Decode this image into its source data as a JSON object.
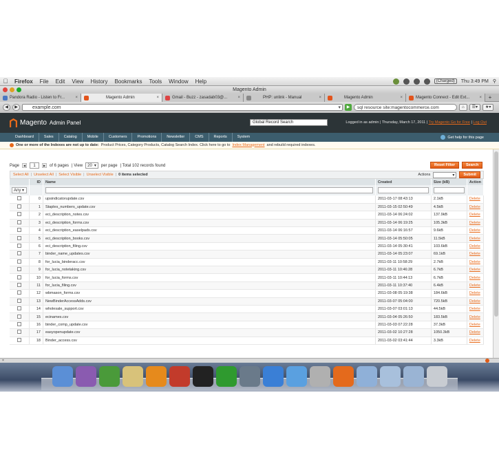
{
  "menubar": {
    "app": "Firefox",
    "items": [
      "File",
      "Edit",
      "View",
      "History",
      "Bookmarks",
      "Tools",
      "Window",
      "Help"
    ],
    "battery": "(Charged)",
    "clock": "Thu 3:49 PM"
  },
  "window": {
    "title": "Magento Admin"
  },
  "tabs": [
    {
      "label": "Pandora Radio - Listen to Fr...",
      "active": false
    },
    {
      "label": "Magento Admin",
      "active": true
    },
    {
      "label": "Gmail - Buzz - zasadab03@...",
      "active": false
    },
    {
      "label": "PHP: unlink - Manual",
      "active": false
    },
    {
      "label": "Magento Admin",
      "active": false
    },
    {
      "label": "Magento Connect - Edit Ext...",
      "active": false
    }
  ],
  "nav": {
    "url": "example.com",
    "search": "sql resource site:magentocommerce.com"
  },
  "header": {
    "logo": "Magento",
    "logo_sub": "Admin Panel",
    "global_search": "Global Record Search",
    "login_info": "Logged in as admin | Thursday, March 17, 2011 |",
    "try_link": "Try Magento Go for Free",
    "logout": "Log Out"
  },
  "menu": {
    "items": [
      "Dashboard",
      "Sales",
      "Catalog",
      "Mobile",
      "Customers",
      "Promotions",
      "Newsletter",
      "CMS",
      "Reports",
      "System"
    ],
    "help": "Get help for this page"
  },
  "notice": {
    "bold": "One or more of the Indexes are not up to date:",
    "text": "Product Prices, Category Products, Catalog Search Index. Click here to go to",
    "link": "Index Management",
    "tail": "and rebuild required indexes."
  },
  "pager": {
    "page_label": "Page",
    "page_value": "1",
    "of_pages": "of 6 pages",
    "view_label": "| View",
    "view_value": "20",
    "per_page": "per page",
    "total": "| Total 102 records found"
  },
  "buttons": {
    "reset": "Reset Filter",
    "search": "Search",
    "submit": "Submit"
  },
  "mass": {
    "select_all": "Select All",
    "unselect_all": "Unselect All",
    "select_visible": "Select Visible",
    "unselect_visible": "Unselect Visible",
    "items_selected": "0 items selected",
    "actions_label": "Actions"
  },
  "grid": {
    "headers": {
      "id": "ID",
      "name": "Name",
      "created": "Created",
      "size": "Size (kB)",
      "action": "Action"
    },
    "filter_any": "Any",
    "delete_label": "Delete",
    "rows": [
      {
        "id": "0",
        "name": "upsindicatorupdate.csv",
        "created": "2011-03-17 08:43:13",
        "size": "2.1kB"
      },
      {
        "id": "1",
        "name": "Staples_numbers_update.csv",
        "created": "2011-03-15 02:50:49",
        "size": "4.5kB"
      },
      {
        "id": "2",
        "name": "eci_description_notes.csv",
        "created": "2011-03-14 06:24:02",
        "size": "137.9kB"
      },
      {
        "id": "3",
        "name": "eci_description_forms.csv",
        "created": "2011-03-14 06:19:25",
        "size": "105.3kB"
      },
      {
        "id": "4",
        "name": "eci_description_easelpads.csv",
        "created": "2011-03-14 06:16:57",
        "size": "9.6kB"
      },
      {
        "id": "5",
        "name": "eci_description_books.csv",
        "created": "2011-03-14 05:50:05",
        "size": "11.5kB"
      },
      {
        "id": "6",
        "name": "eci_description_filing.csv",
        "created": "2011-03-14 05:30:41",
        "size": "103.6kB"
      },
      {
        "id": "7",
        "name": "binder_name_updates.csv",
        "created": "2011-03-14 05:23:07",
        "size": "69.1kB"
      },
      {
        "id": "8",
        "name": "for_lucia_binderacc.csv",
        "created": "2011-03-11 10:58:29",
        "size": "2.7kB"
      },
      {
        "id": "9",
        "name": "for_lucia_notetaking.csv",
        "created": "2011-03-11 10:46:28",
        "size": "6.7kB"
      },
      {
        "id": "10",
        "name": "for_lucia_forms.csv",
        "created": "2011-03-11 10:44:13",
        "size": "6.7kB"
      },
      {
        "id": "11",
        "name": "for_lucia_filing.csv",
        "created": "2011-03-11 10:37:40",
        "size": "6.4kB"
      },
      {
        "id": "12",
        "name": "wbmason_forms.csv",
        "created": "2011-03-08 05:19:38",
        "size": "184.6kB"
      },
      {
        "id": "13",
        "name": "NewBinderAccessAdds.csv",
        "created": "2011-03-07 05:04:00",
        "size": "720.5kB"
      },
      {
        "id": "14",
        "name": "wholesale_support.csv",
        "created": "2011-03-07 03:01:13",
        "size": "44.5kB"
      },
      {
        "id": "15",
        "name": "ecinames.csv",
        "created": "2011-03-04 05:26:50",
        "size": "183.5kB"
      },
      {
        "id": "16",
        "name": "binder_comp_update.csv",
        "created": "2011-03-03 07:22:28",
        "size": "37.3kB"
      },
      {
        "id": "17",
        "name": "easyopenupdate.csv",
        "created": "2011-03-02 10:27:28",
        "size": "1050.3kB"
      },
      {
        "id": "18",
        "name": "Binder_access.csv",
        "created": "2011-03-02 03:41:44",
        "size": "3.3kB"
      }
    ]
  },
  "colors": {
    "accent": "#e86a1a",
    "header_bg": "#2c3437",
    "nav_bg": "#3c5d6d"
  },
  "dock": {
    "icons": [
      "finder-icon",
      "photo-icon",
      "adium-icon",
      "pencil-icon",
      "vlc-icon",
      "mail-icon",
      "terminal-icon",
      "globe-icon",
      "iphoto-icon",
      "safari-icon",
      "bird-icon",
      "scripteditor-icon",
      "firefox-icon",
      "apps-folder-icon",
      "docs-folder-icon",
      "downloads-folder-icon",
      "trash-icon"
    ]
  }
}
